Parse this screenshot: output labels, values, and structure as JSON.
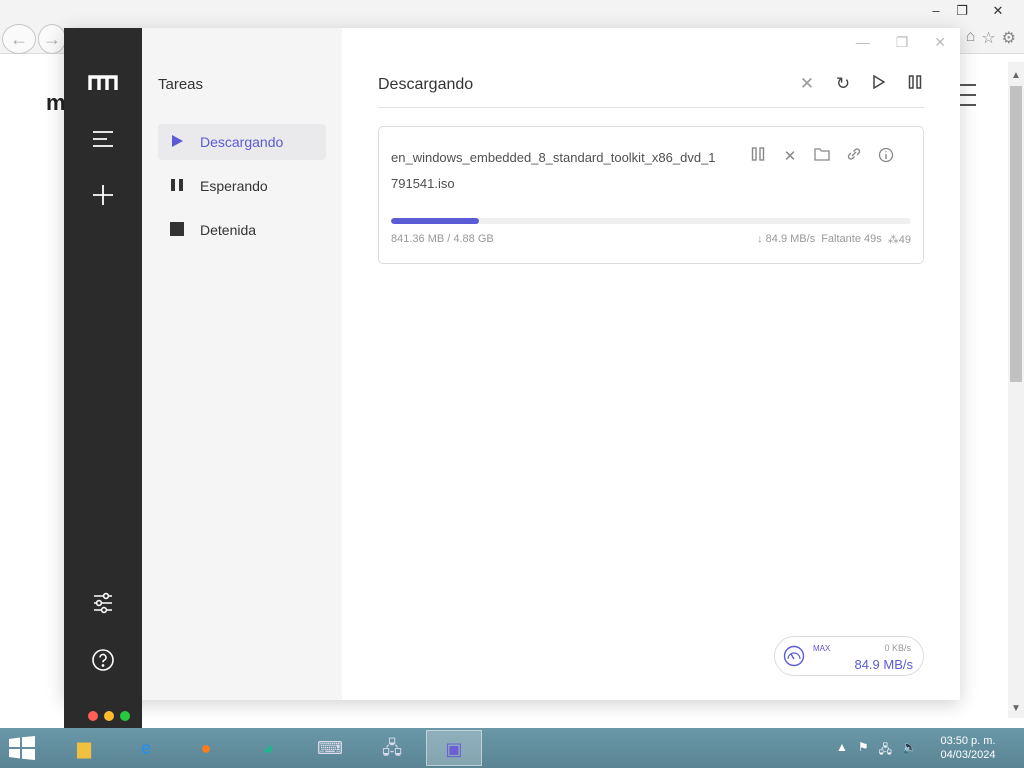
{
  "browser": {
    "back_icon": "arrow-left-icon",
    "forward_icon": "arrow-right-icon",
    "window_controls": {
      "minimize": "–",
      "restore": "❐",
      "close": "✕"
    },
    "bg_logo": "m"
  },
  "app": {
    "sidebar": {
      "logo_icon": "motrix-logo-icon",
      "menu_icon": "menu-icon",
      "add_icon": "plus-icon",
      "settings_icon": "sliders-icon",
      "help_icon": "question-circle-icon",
      "dots": [
        "#ff5f57",
        "#febc2e",
        "#28c840"
      ]
    },
    "tasks": {
      "title": "Tareas",
      "items": [
        {
          "label": "Descargando",
          "icon": "play-icon",
          "active": true
        },
        {
          "label": "Esperando",
          "icon": "pause-icon",
          "active": false
        },
        {
          "label": "Detenida",
          "icon": "stop-icon",
          "active": false
        }
      ]
    },
    "main": {
      "title": "Descargando",
      "actions": [
        "close-icon",
        "refresh-icon",
        "play-icon",
        "pause-icon"
      ],
      "download": {
        "name": "en_windows_embedded_8_standard_toolkit_x86_dvd_1791541.iso",
        "progress": 0.17,
        "size_text": "841.36 MB / 4.88 GB",
        "speed_text": "↓ 84.9 MB/s",
        "remaining_text": "Faltante 49s",
        "connections_text": "⁂49",
        "actions": [
          "pause-icon",
          "close-icon",
          "folder-icon",
          "link-icon",
          "info-icon"
        ]
      },
      "speed_box": {
        "max_label": "MAX",
        "upload": "0 KB/s",
        "download": "84.9 MB/s"
      }
    },
    "accent": "#5b5bd6"
  },
  "taskbar": {
    "clock_time": "03:50 p. m.",
    "clock_date": "04/03/2024"
  }
}
